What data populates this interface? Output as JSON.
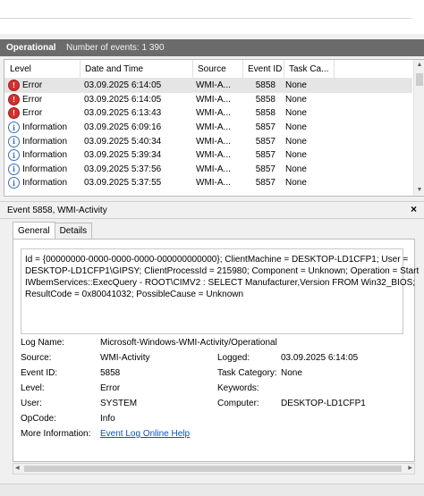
{
  "header": {
    "title": "Operational",
    "count_text": "Number of events: 1 390"
  },
  "list": {
    "columns": [
      "Level",
      "Date and Time",
      "Source",
      "Event ID",
      "Task Ca..."
    ],
    "rows": [
      {
        "level": "Error",
        "icon": "error-icon",
        "date": "03.09.2025 6:14:05",
        "source": "WMI-A...",
        "id": "5858",
        "task": "None",
        "selected": true
      },
      {
        "level": "Error",
        "icon": "error-icon",
        "date": "03.09.2025 6:14:05",
        "source": "WMI-A...",
        "id": "5858",
        "task": "None"
      },
      {
        "level": "Error",
        "icon": "error-icon",
        "date": "03.09.2025 6:13:43",
        "source": "WMI-A...",
        "id": "5858",
        "task": "None"
      },
      {
        "level": "Information",
        "icon": "info-icon",
        "date": "03.09.2025 6:09:16",
        "source": "WMI-A...",
        "id": "5857",
        "task": "None"
      },
      {
        "level": "Information",
        "icon": "info-icon",
        "date": "03.09.2025 5:40:34",
        "source": "WMI-A...",
        "id": "5857",
        "task": "None"
      },
      {
        "level": "Information",
        "icon": "info-icon",
        "date": "03.09.2025 5:39:34",
        "source": "WMI-A...",
        "id": "5857",
        "task": "None"
      },
      {
        "level": "Information",
        "icon": "info-icon",
        "date": "03.09.2025 5:37:56",
        "source": "WMI-A...",
        "id": "5857",
        "task": "None"
      },
      {
        "level": "Information",
        "icon": "info-icon",
        "date": "03.09.2025 5:37:55",
        "source": "WMI-A...",
        "id": "5857",
        "task": "None"
      }
    ]
  },
  "detail": {
    "title": "Event 5858, WMI-Activity",
    "close": "×",
    "tabs": [
      "General",
      "Details"
    ],
    "message_lines": [
      "Id = {00000000-0000-0000-0000-000000000000}; ClientMachine = DESKTOP-LD1CFP1; User =",
      "DESKTOP-LD1CFP1\\GIPSY; ClientProcessId = 215980; Component = Unknown; Operation = Start",
      "IWbemServices::ExecQuery - ROOT\\CIMV2 : SELECT Manufacturer,Version FROM Win32_BIOS;",
      "ResultCode = 0x80041032; PossibleCause = Unknown"
    ],
    "props": {
      "log_name_label": "Log Name:",
      "log_name": "Microsoft-Windows-WMI-Activity/Operational",
      "source_label": "Source:",
      "source": "WMI-Activity",
      "logged_label": "Logged:",
      "logged": "03.09.2025 6:14:05",
      "event_id_label": "Event ID:",
      "event_id": "5858",
      "task_label": "Task Category:",
      "task": "None",
      "level_label": "Level:",
      "level": "Error",
      "keywords_label": "Keywords:",
      "keywords": "",
      "user_label": "User:",
      "user": "SYSTEM",
      "computer_label": "Computer:",
      "computer": "DESKTOP-LD1CFP1",
      "opcode_label": "OpCode:",
      "opcode": "Info",
      "more_info_label": "More Information:",
      "more_info_link": "Event Log Online Help"
    }
  },
  "colors": {
    "header_bg": "#6b6b6b",
    "error_red": "#d32f2f",
    "info_blue": "#3b6fb6",
    "link_blue": "#0a53be"
  }
}
